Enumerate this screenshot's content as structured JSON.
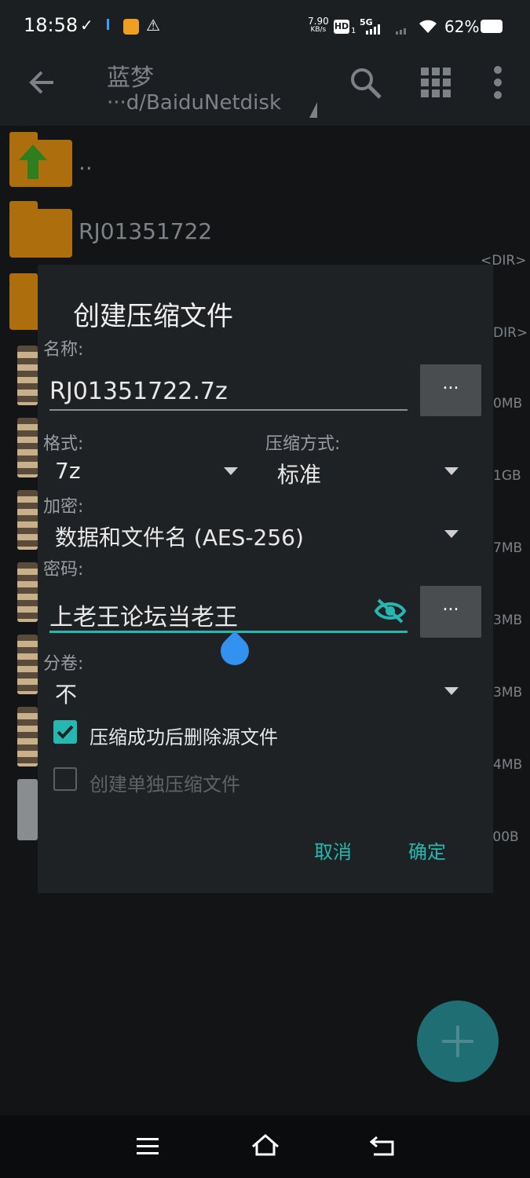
{
  "status_bar": {
    "time": "18:58",
    "net_speed_value": "7.90",
    "net_speed_unit": "KB/s",
    "hd_label": "HD",
    "sim_slot": "1",
    "network_type": "5G",
    "battery": "62%"
  },
  "app_bar": {
    "title": "蓝梦",
    "path": "···d/BaiduNetdisk"
  },
  "file_list": {
    "rows": [
      {
        "name": ".."
      },
      {
        "name": "RJ01351722",
        "size": "<DIR>"
      },
      {
        "size": "DIR>"
      },
      {
        "size": "0MB"
      },
      {
        "size": "1GB"
      },
      {
        "size": "7MB"
      },
      {
        "size": "3MB"
      },
      {
        "size": "3MB"
      },
      {
        "size": "4MB"
      },
      {
        "size": ".00B"
      }
    ]
  },
  "dialog": {
    "title": "创建压缩文件",
    "name_label": "名称:",
    "name_value": "RJ01351722.7z",
    "dots_label": "...",
    "format_label": "格式:",
    "format_value": "7z",
    "method_label": "压缩方式:",
    "method_value": "标准",
    "encryption_label": "加密:",
    "encryption_value": "数据和文件名 (AES-256)",
    "password_label": "密码:",
    "password_value": "上老王论坛当老王",
    "split_label": "分卷:",
    "split_value": "不",
    "delete_after_label": "压缩成功后删除源文件",
    "delete_after_checked": true,
    "separate_archives_label": "创建单独压缩文件",
    "separate_archives_checked": false,
    "cancel_label": "取消",
    "ok_label": "确定"
  },
  "colors": {
    "accent": "#26b7b0",
    "dialog_bg": "#1f2225",
    "folder": "#ad6f0d"
  }
}
